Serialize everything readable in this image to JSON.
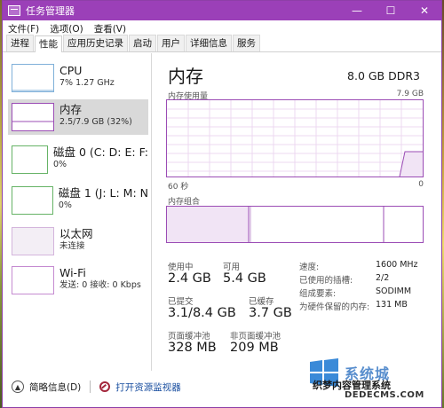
{
  "window": {
    "title": "任务管理器",
    "controls": {
      "minimize": "—",
      "maximize": "☐",
      "close": "✕"
    }
  },
  "menu": {
    "items": [
      "文件(F)",
      "选项(O)",
      "查看(V)"
    ]
  },
  "tabs": [
    {
      "label": "进程",
      "active": false
    },
    {
      "label": "性能",
      "active": true
    },
    {
      "label": "应用历史记录",
      "active": false
    },
    {
      "label": "启动",
      "active": false
    },
    {
      "label": "用户",
      "active": false
    },
    {
      "label": "详细信息",
      "active": false
    },
    {
      "label": "服务",
      "active": false
    }
  ],
  "sidebar": {
    "items": [
      {
        "name": "CPU",
        "sub": "7%  1.27 GHz",
        "kind": "cpu",
        "selected": false
      },
      {
        "name": "内存",
        "sub": "2.5/7.9 GB (32%)",
        "kind": "mem",
        "selected": true
      },
      {
        "name": "磁盘 0 (C: D: E: F:",
        "sub": "0%",
        "kind": "disk",
        "selected": false
      },
      {
        "name": "磁盘 1 (J: L: M: N",
        "sub": "0%",
        "kind": "disk",
        "selected": false
      },
      {
        "name": "以太网",
        "sub": "未连接",
        "kind": "eth",
        "selected": false
      },
      {
        "name": "Wi-Fi",
        "sub": "发送: 0 接收: 0 Kbps",
        "kind": "wifi",
        "selected": false
      }
    ]
  },
  "main": {
    "title": "内存",
    "spec": "8.0 GB DDR3",
    "usage_label": "内存使用量",
    "usage_max": "7.9 GB",
    "axis_left": "60 秒",
    "axis_right": "0",
    "composition_label": "内存组合",
    "stats": {
      "in_use_label": "使用中",
      "in_use": "2.4 GB",
      "available_label": "可用",
      "available": "5.4 GB",
      "committed_label": "已提交",
      "committed": "3.1/8.4 GB",
      "cached_label": "已缓存",
      "cached": "3.7 GB",
      "paged_label": "页面缓冲池",
      "paged": "328 MB",
      "nonpaged_label": "非页面缓冲池",
      "nonpaged": "209 MB"
    },
    "details": [
      {
        "key": "速度:",
        "value": "1600 MHz"
      },
      {
        "key": "已使用的插槽:",
        "value": "2/2"
      },
      {
        "key": "组成要素:",
        "value": "SODIMM"
      },
      {
        "key": "为硬件保留的内存:",
        "value": "131 MB"
      }
    ]
  },
  "footer": {
    "less_details": "简略信息(D)",
    "open_monitor": "打开资源监视器"
  },
  "watermark": {
    "line1": "系统城",
    "line2": "织梦内容管理系统",
    "line3": "DEDECMS.COM"
  },
  "colors": {
    "titlebar": "#9b40b8",
    "memory": "#9b4cb5",
    "cpu": "#7fb0d9",
    "disk": "#66b366"
  }
}
